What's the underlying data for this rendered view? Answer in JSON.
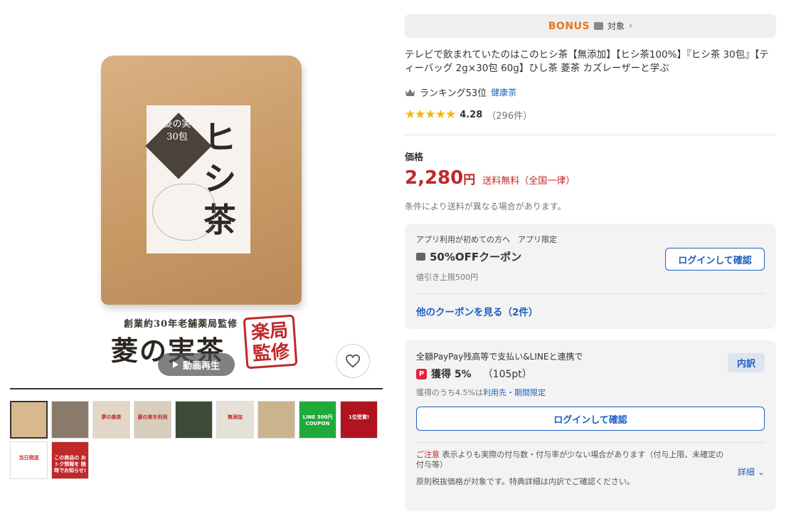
{
  "gallery": {
    "pouch_label_small": "菱の実",
    "pouch_label_count": "30包",
    "pouch_title": "ヒシ茶",
    "brand_sub": "創業約30年老舗薬局監修",
    "brand_main": "菱の実茶",
    "stamp_text": "楽局監修",
    "video_button": "動画再生",
    "thumbnails": [
      {
        "text": "",
        "bg": "#d8b98c"
      },
      {
        "text": "",
        "bg": "#8a7a6a"
      },
      {
        "text": "夢の美茶",
        "bg": "#e3d6c7"
      },
      {
        "text": "菱の実を利用",
        "bg": "#d9cdbe"
      },
      {
        "text": "",
        "bg": "#3d4a35"
      },
      {
        "text": "無添加",
        "bg": "#e6e1d8"
      },
      {
        "text": "",
        "bg": "#c9b48e"
      },
      {
        "text": "LINE 300円 COUPON",
        "bg": "#1faa3a"
      },
      {
        "text": "1位受賞!",
        "bg": "#b0141e"
      },
      {
        "text": "当日発送",
        "bg": "#ffffff"
      },
      {
        "text": "この商品の おトク情報を 随時でお知らせ!",
        "bg": "#c0282a"
      }
    ]
  },
  "bonus": {
    "word": "BONUS",
    "label": "対象"
  },
  "product": {
    "title": "テレビで飲まれていたのはこのヒシ茶【無添加】【ヒシ茶100%】『ヒシ茶 30包』【ティーバッグ 2g×30包 60g】ひし茶 菱茶 カズレーザーと学ぶ",
    "ranking": "ランキング53位",
    "ranking_category": "健康茶",
    "stars": "★★★★★",
    "rating_value": 4.28,
    "rating_score": "4.28",
    "rating_count": "（296件）"
  },
  "price": {
    "label": "価格",
    "amount": "2,280",
    "currency": "円",
    "shipping": "送料無料（全国一律）",
    "note": "条件により送料が異なる場合があります。"
  },
  "coupon": {
    "condition": "アプリ利用が初めての方へ　アプリ限定",
    "name": "50%OFFクーポン",
    "limit": "値引き上限500円",
    "login_button": "ログインして確認",
    "more_link": "他のクーポンを見る（2件）"
  },
  "points": {
    "heading": "全額PayPay残高等で支払い&LINEと連携で",
    "breakdown_button": "内訳",
    "icon_text": "P",
    "earn": "獲得 5%",
    "pts": "（105pt）",
    "sub_prefix": "獲得のうち4.5%は",
    "sub_link": "利用先・期間限定",
    "login_button": "ログインして確認",
    "caution_label": "ご注意",
    "caution_text": "表示よりも実際の付与数・付与率が少ない場合があります（付与上限、未確定の付与等）",
    "detail_link": "詳細",
    "note": "原則税抜価格が対象です。特典詳細は内訳でご確認ください。"
  },
  "colors": {
    "price_red": "#c0282a",
    "link_blue": "#1d5fc1",
    "star_gold": "#f2b705",
    "bonus_orange": "#e8781c"
  }
}
